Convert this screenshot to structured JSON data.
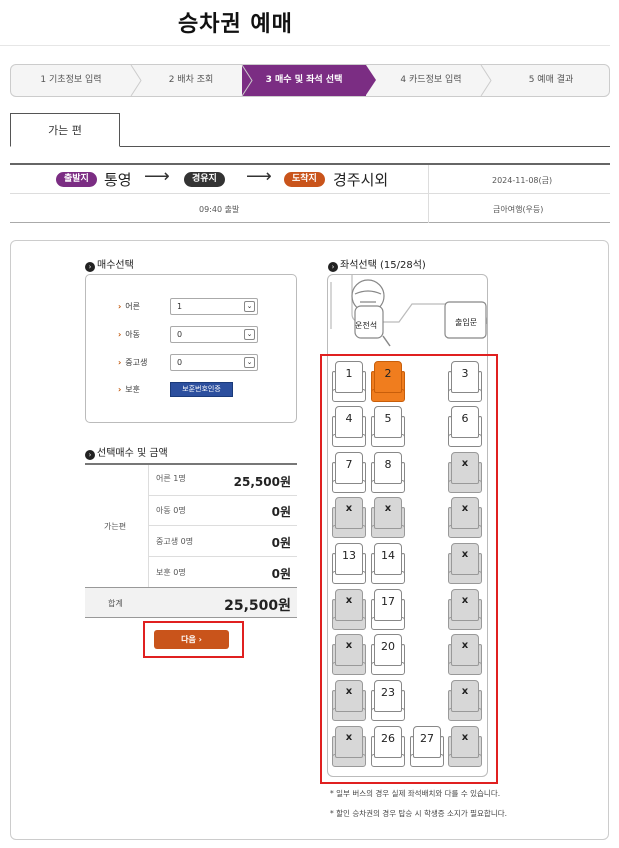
{
  "page_title": "승차권 예매",
  "steps": [
    {
      "label": "1 기초정보 입력",
      "active": false
    },
    {
      "label": "2 배차 조회",
      "active": false
    },
    {
      "label": "3 매수 및 좌석 선택",
      "active": true
    },
    {
      "label": "4 카드정보 입력",
      "active": false
    },
    {
      "label": "5 예매 결과",
      "active": false
    }
  ],
  "tab_label": "가는 편",
  "route": {
    "depart_badge": "출발지",
    "depart": "통영",
    "via_badge": "경유지",
    "arrive_badge": "도착지",
    "arrive": "경주시외",
    "date": "2024-11-08(금)",
    "time": "09:40 출발",
    "company": "금아여행(우등)"
  },
  "colors": {
    "accent_purple": "#7b2d83",
    "accent_orange": "#c9541b",
    "highlight_red": "#e02020",
    "selected_seat": "#f07d1e"
  },
  "count_section": {
    "title": "매수선택",
    "rows": [
      {
        "label": "어른",
        "value": "1"
      },
      {
        "label": "아동",
        "value": "0"
      },
      {
        "label": "중고생",
        "value": "0"
      }
    ],
    "veteran_label": "보훈",
    "veteran_button": "보훈번호인증"
  },
  "summary": {
    "title": "선택매수 및 금액",
    "group_label": "가는편",
    "rows": [
      {
        "label": "어른 1명",
        "value": "25,500원"
      },
      {
        "label": "아동 0명",
        "value": "0원"
      },
      {
        "label": "중고생 0명",
        "value": "0원"
      },
      {
        "label": "보훈 0명",
        "value": "0원"
      }
    ],
    "total_label": "합계",
    "total_value": "25,500원",
    "next_button": "다음 ›"
  },
  "seat_section": {
    "title": "좌석선택 (15/28석)",
    "driver": "운전석",
    "door": "출입문",
    "seats": [
      {
        "n": "1",
        "s": "free"
      },
      {
        "n": "2",
        "s": "selected"
      },
      {
        "n": "3",
        "s": "free"
      },
      {
        "n": "4",
        "s": "free"
      },
      {
        "n": "5",
        "s": "free"
      },
      {
        "n": "6",
        "s": "free"
      },
      {
        "n": "7",
        "s": "free"
      },
      {
        "n": "8",
        "s": "free"
      },
      {
        "n": "x",
        "s": "taken"
      },
      {
        "n": "x",
        "s": "taken"
      },
      {
        "n": "x",
        "s": "taken"
      },
      {
        "n": "x",
        "s": "taken"
      },
      {
        "n": "13",
        "s": "free"
      },
      {
        "n": "14",
        "s": "free"
      },
      {
        "n": "x",
        "s": "taken"
      },
      {
        "n": "x",
        "s": "taken"
      },
      {
        "n": "17",
        "s": "free"
      },
      {
        "n": "x",
        "s": "taken"
      },
      {
        "n": "x",
        "s": "taken"
      },
      {
        "n": "20",
        "s": "free"
      },
      {
        "n": "x",
        "s": "taken"
      },
      {
        "n": "x",
        "s": "taken"
      },
      {
        "n": "23",
        "s": "free"
      },
      {
        "n": "x",
        "s": "taken"
      },
      {
        "n": "x",
        "s": "taken"
      },
      {
        "n": "26",
        "s": "free"
      },
      {
        "n": "27",
        "s": "free"
      },
      {
        "n": "x",
        "s": "taken"
      }
    ]
  },
  "notes": [
    "* 일부 버스의 경우 실제 좌석배치와 다를 수 있습니다.",
    "* 할인 승차권의 경우 탑승 시 학생증 소지가 필요합니다."
  ]
}
